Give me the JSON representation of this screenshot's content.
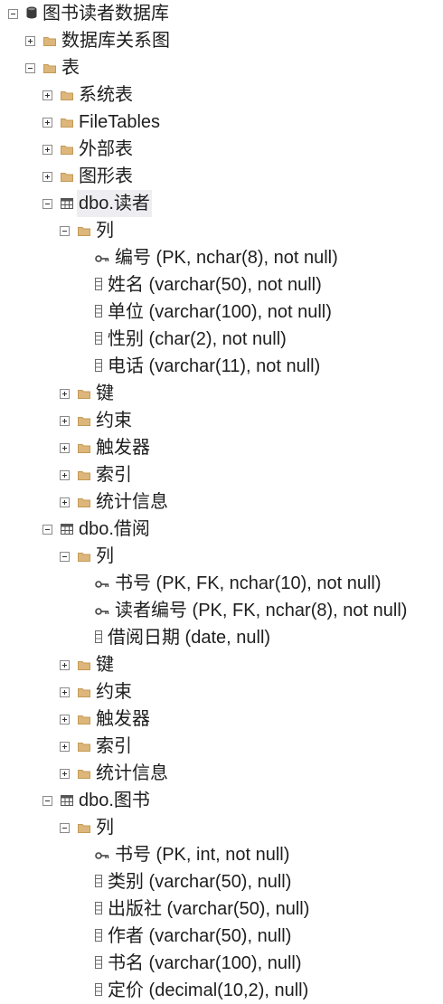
{
  "tree": [
    {
      "level": 0,
      "toggle": "minus",
      "icon": "database-icon",
      "label": "图书读者数据库"
    },
    {
      "level": 1,
      "toggle": "plus",
      "icon": "folder-icon",
      "label": "数据库关系图"
    },
    {
      "level": 1,
      "toggle": "minus",
      "icon": "folder-icon",
      "label": "表"
    },
    {
      "level": 2,
      "toggle": "plus",
      "icon": "folder-icon",
      "label": "系统表"
    },
    {
      "level": 2,
      "toggle": "plus",
      "icon": "folder-icon",
      "label": "FileTables"
    },
    {
      "level": 2,
      "toggle": "plus",
      "icon": "folder-icon",
      "label": "外部表"
    },
    {
      "level": 2,
      "toggle": "plus",
      "icon": "folder-icon",
      "label": "图形表"
    },
    {
      "level": 2,
      "toggle": "minus",
      "icon": "table-icon",
      "label": "dbo.读者",
      "selected": true
    },
    {
      "level": 3,
      "toggle": "minus",
      "icon": "folder-icon",
      "label": "列"
    },
    {
      "level": 4,
      "toggle": "none",
      "icon": "key-icon",
      "label": "编号 (PK, nchar(8), not null)"
    },
    {
      "level": 4,
      "toggle": "none",
      "icon": "column-icon",
      "label": "姓名 (varchar(50), not null)"
    },
    {
      "level": 4,
      "toggle": "none",
      "icon": "column-icon",
      "label": "单位 (varchar(100), not null)"
    },
    {
      "level": 4,
      "toggle": "none",
      "icon": "column-icon",
      "label": "性别 (char(2), not null)"
    },
    {
      "level": 4,
      "toggle": "none",
      "icon": "column-icon",
      "label": "电话 (varchar(11), not null)"
    },
    {
      "level": 3,
      "toggle": "plus",
      "icon": "folder-icon",
      "label": "键"
    },
    {
      "level": 3,
      "toggle": "plus",
      "icon": "folder-icon",
      "label": "约束"
    },
    {
      "level": 3,
      "toggle": "plus",
      "icon": "folder-icon",
      "label": "触发器"
    },
    {
      "level": 3,
      "toggle": "plus",
      "icon": "folder-icon",
      "label": "索引"
    },
    {
      "level": 3,
      "toggle": "plus",
      "icon": "folder-icon",
      "label": "统计信息"
    },
    {
      "level": 2,
      "toggle": "minus",
      "icon": "table-icon",
      "label": "dbo.借阅"
    },
    {
      "level": 3,
      "toggle": "minus",
      "icon": "folder-icon",
      "label": "列"
    },
    {
      "level": 4,
      "toggle": "none",
      "icon": "key-icon",
      "label": "书号 (PK, FK, nchar(10), not null)"
    },
    {
      "level": 4,
      "toggle": "none",
      "icon": "key-icon",
      "label": "读者编号 (PK, FK, nchar(8), not null)"
    },
    {
      "level": 4,
      "toggle": "none",
      "icon": "column-icon",
      "label": "借阅日期 (date, null)"
    },
    {
      "level": 3,
      "toggle": "plus",
      "icon": "folder-icon",
      "label": "键"
    },
    {
      "level": 3,
      "toggle": "plus",
      "icon": "folder-icon",
      "label": "约束"
    },
    {
      "level": 3,
      "toggle": "plus",
      "icon": "folder-icon",
      "label": "触发器"
    },
    {
      "level": 3,
      "toggle": "plus",
      "icon": "folder-icon",
      "label": "索引"
    },
    {
      "level": 3,
      "toggle": "plus",
      "icon": "folder-icon",
      "label": "统计信息"
    },
    {
      "level": 2,
      "toggle": "minus",
      "icon": "table-icon",
      "label": "dbo.图书"
    },
    {
      "level": 3,
      "toggle": "minus",
      "icon": "folder-icon",
      "label": "列"
    },
    {
      "level": 4,
      "toggle": "none",
      "icon": "key-icon",
      "label": "书号 (PK, int, not null)"
    },
    {
      "level": 4,
      "toggle": "none",
      "icon": "column-icon",
      "label": "类别 (varchar(50), null)"
    },
    {
      "level": 4,
      "toggle": "none",
      "icon": "column-icon",
      "label": "出版社 (varchar(50), null)"
    },
    {
      "level": 4,
      "toggle": "none",
      "icon": "column-icon",
      "label": "作者 (varchar(50), null)"
    },
    {
      "level": 4,
      "toggle": "none",
      "icon": "column-icon",
      "label": "书名 (varchar(100), null)"
    },
    {
      "level": 4,
      "toggle": "none",
      "icon": "column-icon",
      "label": "定价 (decimal(10,2), null)"
    }
  ],
  "colors": {
    "folder": "#dcb67a",
    "database": "#3a3a3a",
    "table": "#555555",
    "key": "#444444",
    "column": "#6a6a6a",
    "selection": "#eeeef2"
  }
}
